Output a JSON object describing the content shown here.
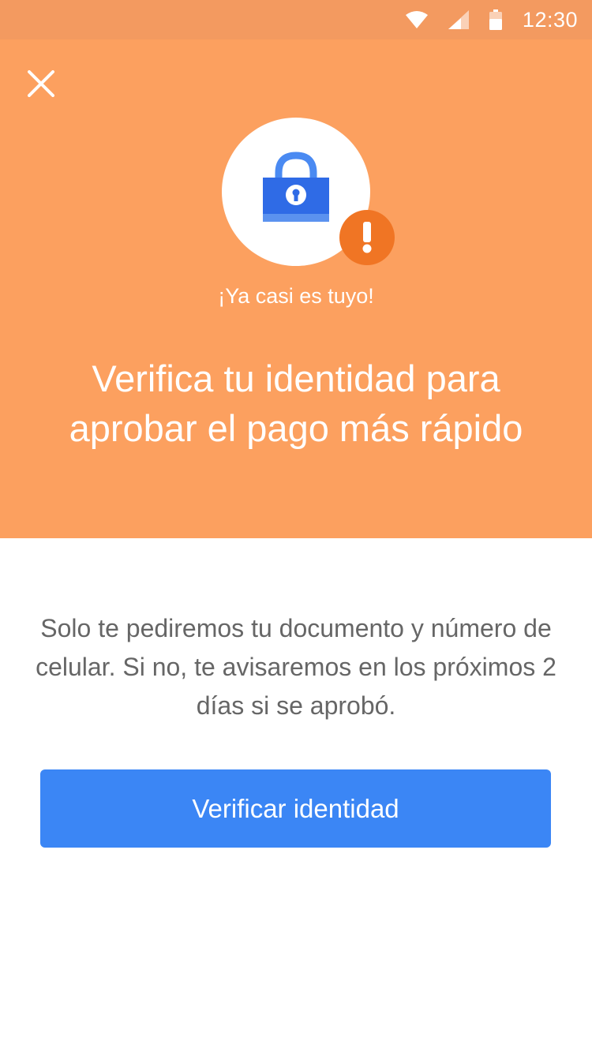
{
  "status_bar": {
    "time": "12:30",
    "icons": [
      "wifi-icon",
      "signal-icon",
      "battery-icon"
    ],
    "background": "#f39a60"
  },
  "hero": {
    "background": "#fca05f",
    "close_icon": "close-icon",
    "lock_icon": "lock-icon",
    "alert_icon": "exclamation-icon",
    "subtitle": "¡Ya casi es tuyo!",
    "headline": "Verifica tu identidad para aprobar el pago más rápido"
  },
  "content": {
    "body": "Solo te pediremos tu documento y número de celular. Si no, te avisaremos en los próximos 2 días si se aprobó.",
    "button_label": "Verificar identidad"
  },
  "colors": {
    "accent_blue": "#3b86f5",
    "lock_blue": "#2f6be6",
    "alert_orange": "#f07524",
    "text_gray": "#666666"
  }
}
